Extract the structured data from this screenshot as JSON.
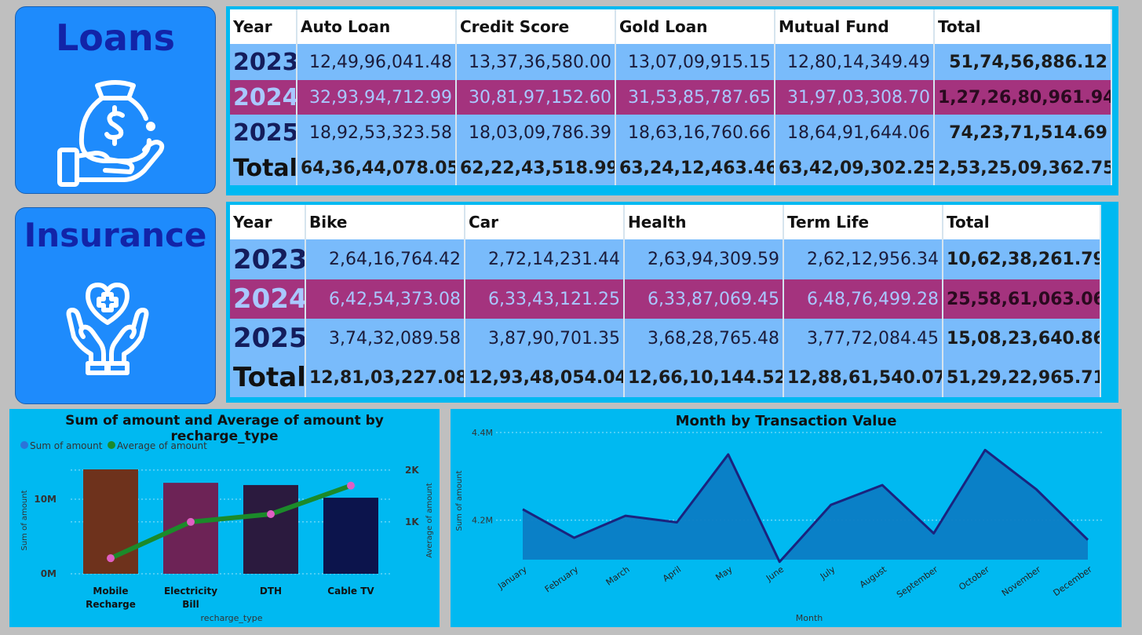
{
  "loans": {
    "title": "Loans",
    "icon": "money-bag-hand-icon",
    "headers": [
      "Year",
      "Auto Loan",
      "Credit Score",
      "Gold Loan",
      "Mutual Fund",
      "Total"
    ],
    "rows": [
      {
        "year": "2023",
        "values": [
          "12,49,96,041.48",
          "13,37,36,580.00",
          "13,07,09,915.15",
          "12,80,14,349.49"
        ],
        "total": "51,74,56,886.12"
      },
      {
        "year": "2024",
        "values": [
          "32,93,94,712.99",
          "30,81,97,152.60",
          "31,53,85,787.65",
          "31,97,03,308.70"
        ],
        "total": "1,27,26,80,961.94"
      },
      {
        "year": "2025",
        "values": [
          "18,92,53,323.58",
          "18,03,09,786.39",
          "18,63,16,760.66",
          "18,64,91,644.06"
        ],
        "total": "74,23,71,514.69"
      }
    ],
    "total_row": {
      "label": "Total",
      "values": [
        "64,36,44,078.05",
        "62,22,43,518.99",
        "63,24,12,463.46",
        "63,42,09,302.25"
      ],
      "total": "2,53,25,09,362.75"
    }
  },
  "insurance": {
    "title": "Insurance",
    "icon": "heart-hands-care-icon",
    "headers": [
      "Year",
      "Bike",
      "Car",
      "Health",
      "Term Life",
      "Total"
    ],
    "rows": [
      {
        "year": "2023",
        "values": [
          "2,64,16,764.42",
          "2,72,14,231.44",
          "2,63,94,309.59",
          "2,62,12,956.34"
        ],
        "total": "10,62,38,261.79"
      },
      {
        "year": "2024",
        "values": [
          "6,42,54,373.08",
          "6,33,43,121.25",
          "6,33,87,069.45",
          "6,48,76,499.28"
        ],
        "total": "25,58,61,063.06"
      },
      {
        "year": "2025",
        "values": [
          "3,74,32,089.58",
          "3,87,90,701.35",
          "3,68,28,765.48",
          "3,77,72,084.45"
        ],
        "total": "15,08,23,640.86"
      }
    ],
    "total_row": {
      "label": "Total",
      "values": [
        "12,81,03,227.08",
        "12,93,48,054.04",
        "12,66,10,144.52",
        "12,88,61,540.07"
      ],
      "total": "51,29,22,965.71"
    }
  },
  "colors": {
    "background": "#bfbfbf",
    "panel": "#00b9f1",
    "tile": "#1e8bfc",
    "tile_title": "#1224a8",
    "row": "#79bbfb",
    "highlight_row": "#a4337e",
    "area_fill": "#0b7cc4",
    "area_line": "#1a237e",
    "avg_line": "#1b8a2a",
    "avg_marker": "#e05fc4",
    "legend_sum": "#2b74d9"
  },
  "chart_data": [
    {
      "type": "bar",
      "title": "Sum of amount and Average of amount by recharge_type",
      "legend": [
        "Sum of amount",
        "Average of amount"
      ],
      "legend_position": "top-left",
      "xlabel": "recharge_type",
      "ylabel": "Sum of amount",
      "y2label": "Average of amount",
      "categories": [
        "Mobile\nRecharge",
        "Electricity\nBill",
        "DTH",
        "Cable TV"
      ],
      "series": [
        {
          "name": "Sum of amount",
          "kind": "bar",
          "axis": "left",
          "values": [
            14000000,
            12200000,
            11900000,
            10200000
          ],
          "colors": [
            "#6e321c",
            "#6d2356",
            "#2b1a3e",
            "#0c144c"
          ]
        },
        {
          "name": "Average of amount",
          "kind": "line",
          "axis": "right",
          "values": [
            300,
            1000,
            1150,
            1700
          ]
        }
      ],
      "ylim": [
        0,
        16000000
      ],
      "y2lim": [
        0,
        2300
      ],
      "yticks": [
        {
          "v": 0,
          "label": "0M"
        },
        {
          "v": 10000000,
          "label": "10M"
        }
      ],
      "y2ticks": [
        {
          "v": 1000,
          "label": "1K"
        },
        {
          "v": 2000,
          "label": "2K"
        }
      ],
      "grid": true
    },
    {
      "type": "area",
      "title": "Month by Transaction Value",
      "xlabel": "Month",
      "ylabel": "Sum of amount",
      "categories": [
        "January",
        "February",
        "March",
        "April",
        "May",
        "June",
        "July",
        "August",
        "September",
        "October",
        "November",
        "December"
      ],
      "values": [
        4225000,
        4160000,
        4210000,
        4195000,
        4350000,
        4105000,
        4235000,
        4280000,
        4170000,
        4360000,
        4270000,
        4155000
      ],
      "ylim": [
        4110000,
        4400000
      ],
      "yticks": [
        {
          "v": 4200000,
          "label": "4.2M"
        },
        {
          "v": 4400000,
          "label": "4.4M"
        }
      ],
      "grid": true
    }
  ]
}
